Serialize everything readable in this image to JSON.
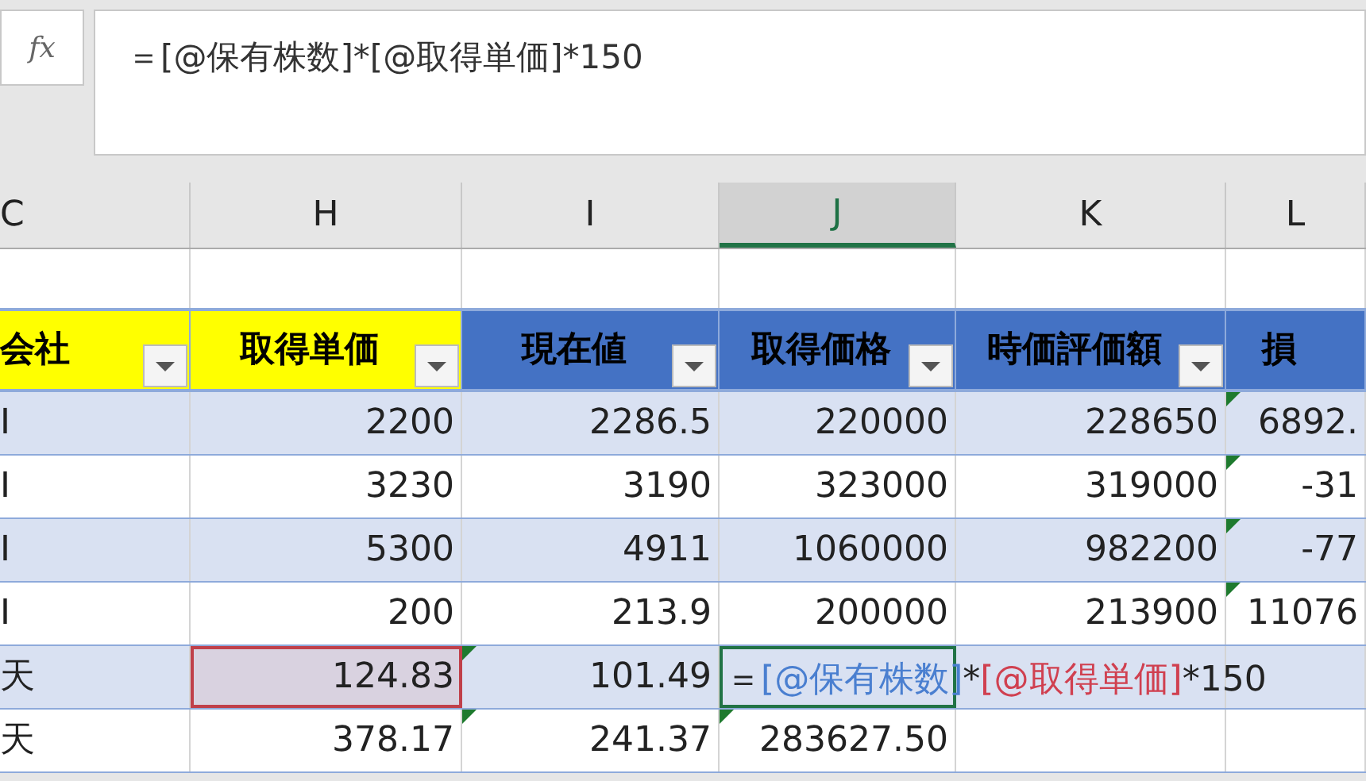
{
  "formula_bar": {
    "fx": "fx",
    "formula": "＝[@保有株数]*[@取得単価]*150"
  },
  "columns": [
    {
      "label": "C",
      "selected": false
    },
    {
      "label": "H",
      "selected": false
    },
    {
      "label": "I",
      "selected": false
    },
    {
      "label": "J",
      "selected": true
    },
    {
      "label": "K",
      "selected": false
    },
    {
      "label": "L",
      "selected": false
    }
  ],
  "table": {
    "headers": [
      {
        "label": "会社",
        "color": "#ffff00",
        "filter": true
      },
      {
        "label": "取得単価",
        "color": "#ffff00",
        "filter": true
      },
      {
        "label": "現在値",
        "color": "#4472c4",
        "filter": true
      },
      {
        "label": "取得価格",
        "color": "#4472c4",
        "filter": true
      },
      {
        "label": "時価評価額",
        "color": "#4472c4",
        "filter": true
      },
      {
        "label": "損",
        "color": "#4472c4",
        "filter": false
      }
    ],
    "rows": [
      {
        "cells": [
          {
            "kind": "value",
            "text": "I",
            "flag": false
          },
          {
            "kind": "value",
            "text": "2200",
            "flag": false
          },
          {
            "kind": "value",
            "text": "2286.5",
            "flag": false
          },
          {
            "kind": "value",
            "text": "220000",
            "flag": false
          },
          {
            "kind": "value",
            "text": "228650",
            "flag": false
          },
          {
            "kind": "value",
            "text": "6892.",
            "flag": true
          }
        ]
      },
      {
        "cells": [
          {
            "kind": "value",
            "text": "I",
            "flag": false
          },
          {
            "kind": "value",
            "text": "3230",
            "flag": false
          },
          {
            "kind": "value",
            "text": "3190",
            "flag": false
          },
          {
            "kind": "value",
            "text": "323000",
            "flag": false
          },
          {
            "kind": "value",
            "text": "319000",
            "flag": false
          },
          {
            "kind": "value",
            "text": "-31",
            "flag": true
          }
        ]
      },
      {
        "cells": [
          {
            "kind": "value",
            "text": "I",
            "flag": false
          },
          {
            "kind": "value",
            "text": "5300",
            "flag": false
          },
          {
            "kind": "value",
            "text": "4911",
            "flag": false
          },
          {
            "kind": "value",
            "text": "1060000",
            "flag": false
          },
          {
            "kind": "value",
            "text": "982200",
            "flag": false
          },
          {
            "kind": "value",
            "text": "-77",
            "flag": true
          }
        ]
      },
      {
        "cells": [
          {
            "kind": "value",
            "text": "I",
            "flag": false
          },
          {
            "kind": "value",
            "text": "200",
            "flag": false
          },
          {
            "kind": "value",
            "text": "213.9",
            "flag": false
          },
          {
            "kind": "value",
            "text": "200000",
            "flag": false
          },
          {
            "kind": "value",
            "text": "213900",
            "flag": false
          },
          {
            "kind": "value",
            "text": "11076",
            "flag": true
          }
        ]
      },
      {
        "cells": [
          {
            "kind": "value",
            "text": "天",
            "flag": false
          },
          {
            "kind": "reference",
            "text": "124.83",
            "flag": false
          },
          {
            "kind": "value",
            "text": "101.49",
            "flag": true
          },
          {
            "kind": "editing",
            "parts": [
              {
                "text": "＝",
                "color": "#222222"
              },
              {
                "text": "[@保有株数]",
                "color": "#4a7fd0"
              },
              {
                "text": "*",
                "color": "#222222"
              },
              {
                "text": "[@取得単価]",
                "color": "#d04050"
              },
              {
                "text": "*150",
                "color": "#222222"
              }
            ]
          },
          {
            "kind": "value",
            "text": "",
            "flag": false
          },
          {
            "kind": "value",
            "text": "",
            "flag": false
          }
        ]
      },
      {
        "cells": [
          {
            "kind": "value",
            "text": "天",
            "flag": false
          },
          {
            "kind": "value",
            "text": "378.17",
            "flag": false
          },
          {
            "kind": "value",
            "text": "241.37",
            "flag": true
          },
          {
            "kind": "value",
            "text": "283627.50",
            "flag": true
          },
          {
            "kind": "value",
            "text": "",
            "flag": false
          },
          {
            "kind": "value",
            "text": "",
            "flag": false
          }
        ]
      }
    ]
  }
}
